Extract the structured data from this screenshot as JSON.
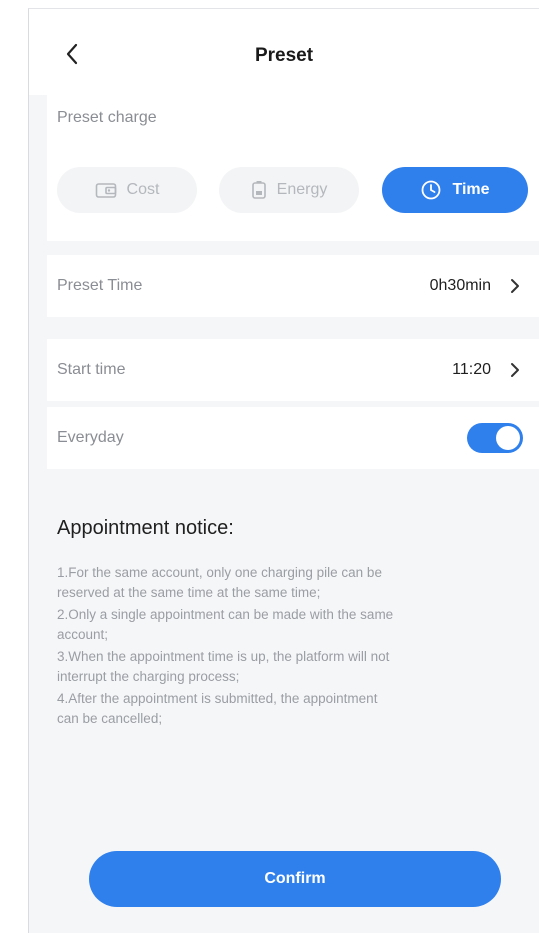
{
  "header": {
    "title": "Preset"
  },
  "preset_charge": {
    "label": "Preset charge",
    "options": [
      {
        "label": "Cost",
        "icon": "wallet-icon",
        "active": false
      },
      {
        "label": "Energy",
        "icon": "battery-icon",
        "active": false
      },
      {
        "label": "Time",
        "icon": "clock-icon",
        "active": true
      }
    ]
  },
  "preset_time": {
    "label": "Preset Time",
    "value": "0h30min"
  },
  "start_time": {
    "label": "Start time",
    "value": "11:20"
  },
  "everyday": {
    "label": "Everyday",
    "enabled": true
  },
  "notice": {
    "title": "Appointment notice:",
    "lines": [
      "1.For the same account, only one charging pile can be",
      "reserved at the same time at the same time;",
      "2.Only a single appointment can be made with the same",
      "account;",
      "3.When the appointment time is up, the platform will not",
      "interrupt the charging process;",
      "4.After the appointment is submitted, the appointment",
      "can be cancelled;"
    ]
  },
  "confirm": {
    "label": "Confirm"
  },
  "colors": {
    "accent": "#2f80ed",
    "background": "#f5f6f8",
    "muted_text": "#8a8d93"
  }
}
